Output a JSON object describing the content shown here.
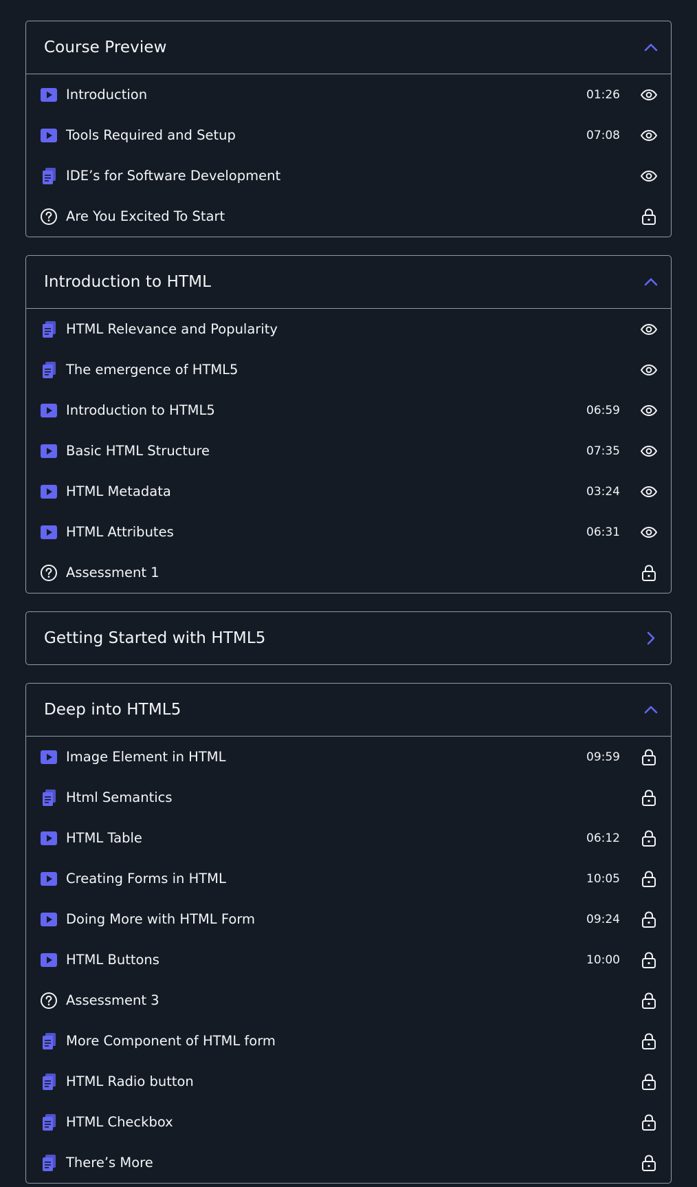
{
  "colors": {
    "background": "#151b24",
    "border": "#8f9aa8",
    "accent": "#6366f1",
    "text": "#f4f6f9"
  },
  "sections": [
    {
      "title": "Course Preview",
      "open": true,
      "items": [
        {
          "type": "video",
          "label": "Introduction",
          "duration": "01:26",
          "access": "preview"
        },
        {
          "type": "video",
          "label": "Tools Required and Setup",
          "duration": "07:08",
          "access": "preview"
        },
        {
          "type": "doc",
          "label": "IDE’s for Software Development",
          "duration": "",
          "access": "preview"
        },
        {
          "type": "quiz",
          "label": "Are You Excited To Start",
          "duration": "",
          "access": "locked"
        }
      ]
    },
    {
      "title": "Introduction to HTML",
      "open": true,
      "items": [
        {
          "type": "doc",
          "label": "HTML Relevance and Popularity",
          "duration": "",
          "access": "preview"
        },
        {
          "type": "doc",
          "label": "The emergence of HTML5",
          "duration": "",
          "access": "preview"
        },
        {
          "type": "video",
          "label": "Introduction to HTML5",
          "duration": "06:59",
          "access": "preview"
        },
        {
          "type": "video",
          "label": "Basic HTML Structure",
          "duration": "07:35",
          "access": "preview"
        },
        {
          "type": "video",
          "label": "HTML Metadata",
          "duration": "03:24",
          "access": "preview"
        },
        {
          "type": "video",
          "label": "HTML Attributes",
          "duration": "06:31",
          "access": "preview"
        },
        {
          "type": "quiz",
          "label": "Assessment 1",
          "duration": "",
          "access": "locked"
        }
      ]
    },
    {
      "title": "Getting Started with HTML5",
      "open": false,
      "items": []
    },
    {
      "title": "Deep into HTML5",
      "open": true,
      "items": [
        {
          "type": "video",
          "label": "Image Element in HTML",
          "duration": "09:59",
          "access": "locked"
        },
        {
          "type": "doc",
          "label": "Html Semantics",
          "duration": "",
          "access": "locked"
        },
        {
          "type": "video",
          "label": "HTML Table",
          "duration": "06:12",
          "access": "locked"
        },
        {
          "type": "video",
          "label": "Creating Forms in HTML",
          "duration": "10:05",
          "access": "locked"
        },
        {
          "type": "video",
          "label": "Doing More with HTML Form",
          "duration": "09:24",
          "access": "locked"
        },
        {
          "type": "video",
          "label": "HTML Buttons",
          "duration": "10:00",
          "access": "locked"
        },
        {
          "type": "quiz",
          "label": "Assessment 3",
          "duration": "",
          "access": "locked"
        },
        {
          "type": "doc",
          "label": "More Component of HTML form",
          "duration": "",
          "access": "locked"
        },
        {
          "type": "doc",
          "label": "HTML Radio button",
          "duration": "",
          "access": "locked"
        },
        {
          "type": "doc",
          "label": "HTML Checkbox",
          "duration": "",
          "access": "locked"
        },
        {
          "type": "doc",
          "label": "There’s More",
          "duration": "",
          "access": "locked"
        }
      ]
    }
  ]
}
